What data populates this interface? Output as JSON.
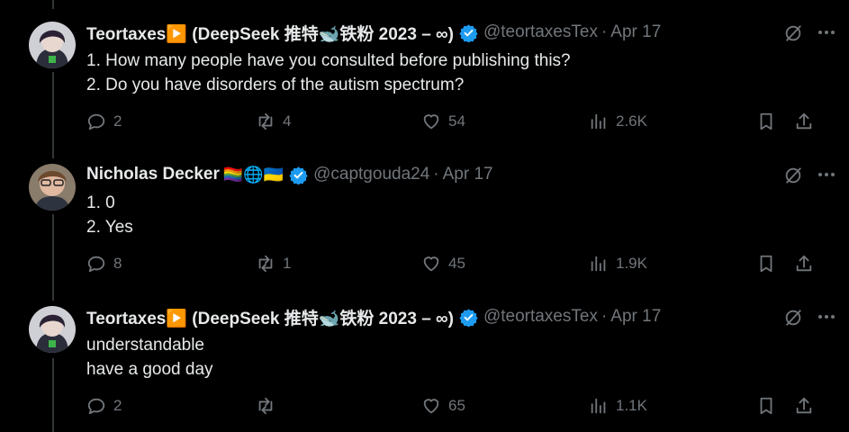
{
  "tweets": [
    {
      "name": "Teortaxes▶️ (DeepSeek 推特🐋铁粉 2023 – ∞)",
      "emoji": "",
      "handle": "@teortaxesTex",
      "dot": "·",
      "date": "Apr 17",
      "lines": [
        "1. How many people have you consulted before publishing this?",
        "2. Do you have disorders of the autism spectrum?"
      ],
      "replies": "2",
      "reposts": "4",
      "likes": "54",
      "views": "2.6K"
    },
    {
      "name": "Nicholas Decker",
      "emoji": "🏳️‍🌈🌐🇺🇦",
      "handle": "@captgouda24",
      "dot": "·",
      "date": "Apr 17",
      "lines": [
        "1. 0",
        "2. Yes"
      ],
      "replies": "8",
      "reposts": "1",
      "likes": "45",
      "views": "1.9K"
    },
    {
      "name": "Teortaxes▶️ (DeepSeek 推特🐋铁粉 2023 – ∞)",
      "emoji": "",
      "handle": "@teortaxesTex",
      "dot": "·",
      "date": "Apr 17",
      "lines": [
        "understandable",
        "have a good day"
      ],
      "replies": "2",
      "reposts": "",
      "likes": "65",
      "views": "1.1K"
    }
  ],
  "colors": {
    "background": "#000000",
    "text": "#e7e9ea",
    "muted": "#71767b",
    "verified": "#1d9bf0",
    "thread_line": "#333639"
  },
  "icons": [
    "reply-icon",
    "repost-icon",
    "like-icon",
    "views-icon",
    "bookmark-icon",
    "share-icon",
    "grok-icon",
    "more-icon",
    "verified-icon"
  ]
}
